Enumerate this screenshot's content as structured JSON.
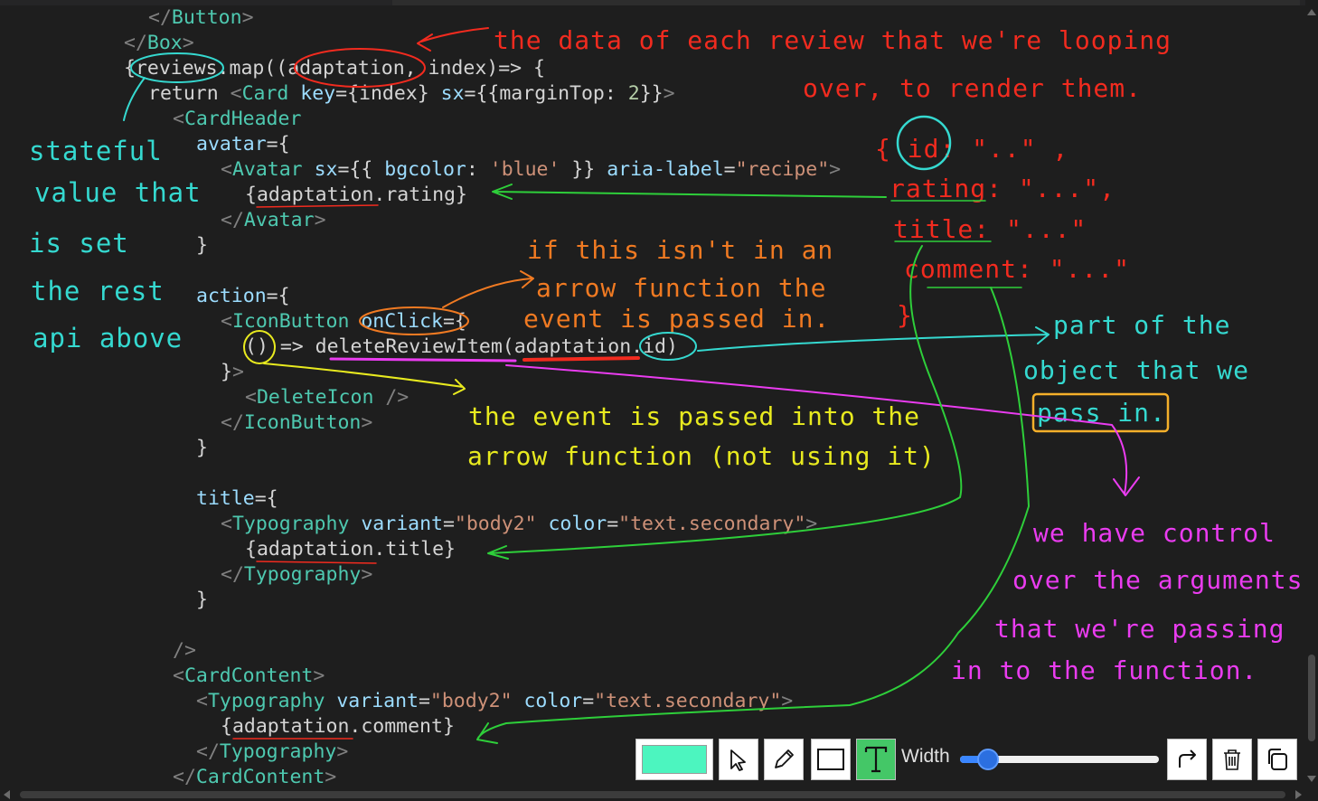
{
  "editor": {
    "code_lines": [
      {
        "parts": [
          [
            "br",
            "</"
          ],
          [
            "tag",
            "Button"
          ],
          [
            "br",
            ">"
          ]
        ]
      },
      {
        "parts": [
          [
            "br",
            "</"
          ],
          [
            "tag",
            "Box"
          ],
          [
            "br",
            ">"
          ]
        ]
      },
      {
        "parts": [
          [
            "kw",
            "{reviews.map((adaptation, index)=> {"
          ]
        ]
      },
      {
        "parts": [
          [
            "kw",
            "return "
          ],
          [
            "br",
            "<"
          ],
          [
            "tag",
            "Card"
          ],
          [
            "kw",
            " "
          ],
          [
            "attr",
            "key"
          ],
          [
            "kw",
            "={index} "
          ],
          [
            "attr",
            "sx"
          ],
          [
            "kw",
            "={{marginTop: "
          ],
          [
            "num",
            "2"
          ],
          [
            "kw",
            "}}"
          ],
          [
            "br",
            ">"
          ]
        ]
      },
      {
        "parts": [
          [
            "br",
            "<"
          ],
          [
            "tag",
            "CardHeader"
          ]
        ]
      },
      {
        "parts": [
          [
            "attr",
            "avatar"
          ],
          [
            "kw",
            "={"
          ]
        ]
      },
      {
        "parts": [
          [
            "br",
            "<"
          ],
          [
            "tag",
            "Avatar"
          ],
          [
            "kw",
            " "
          ],
          [
            "attr",
            "sx"
          ],
          [
            "kw",
            "={{ "
          ],
          [
            "attr",
            "bgcolor"
          ],
          [
            "kw",
            ": "
          ],
          [
            "str",
            "'blue'"
          ],
          [
            "kw",
            " }} "
          ],
          [
            "attr",
            "aria-label"
          ],
          [
            "kw",
            "="
          ],
          [
            "str",
            "\"recipe\""
          ],
          [
            "br",
            ">"
          ]
        ]
      },
      {
        "parts": [
          [
            "kw",
            "{adaptation.rating}"
          ]
        ]
      },
      {
        "parts": [
          [
            "br",
            "</"
          ],
          [
            "tag",
            "Avatar"
          ],
          [
            "br",
            ">"
          ]
        ]
      },
      {
        "parts": [
          [
            "kw",
            "}"
          ]
        ]
      },
      {
        "parts": [
          [
            "kw",
            ""
          ]
        ]
      },
      {
        "parts": [
          [
            "attr",
            "action"
          ],
          [
            "kw",
            "={"
          ]
        ]
      },
      {
        "parts": [
          [
            "br",
            "<"
          ],
          [
            "tag",
            "IconButton"
          ],
          [
            "kw",
            " "
          ],
          [
            "attr",
            "onClick"
          ],
          [
            "kw",
            "={"
          ]
        ]
      },
      {
        "parts": [
          [
            "kw",
            "() => deleteReviewItem(adaptation.id)"
          ]
        ]
      },
      {
        "parts": [
          [
            "kw",
            "}"
          ],
          [
            "br",
            ">"
          ]
        ]
      },
      {
        "parts": [
          [
            "br",
            "<"
          ],
          [
            "tag",
            "DeleteIcon"
          ],
          [
            "kw",
            " "
          ],
          [
            "br",
            "/>"
          ]
        ]
      },
      {
        "parts": [
          [
            "br",
            "</"
          ],
          [
            "tag",
            "IconButton"
          ],
          [
            "br",
            ">"
          ]
        ]
      },
      {
        "parts": [
          [
            "kw",
            "}"
          ]
        ]
      },
      {
        "parts": [
          [
            "kw",
            ""
          ]
        ]
      },
      {
        "parts": [
          [
            "attr",
            "title"
          ],
          [
            "kw",
            "={"
          ]
        ]
      },
      {
        "parts": [
          [
            "br",
            "<"
          ],
          [
            "tag",
            "Typography"
          ],
          [
            "kw",
            " "
          ],
          [
            "attr",
            "variant"
          ],
          [
            "kw",
            "="
          ],
          [
            "str",
            "\"body2\""
          ],
          [
            "kw",
            " "
          ],
          [
            "attr",
            "color"
          ],
          [
            "kw",
            "="
          ],
          [
            "str",
            "\"text.secondary\""
          ],
          [
            "br",
            ">"
          ]
        ]
      },
      {
        "parts": [
          [
            "kw",
            "{adaptation.title}"
          ]
        ]
      },
      {
        "parts": [
          [
            "br",
            "</"
          ],
          [
            "tag",
            "Typography"
          ],
          [
            "br",
            ">"
          ]
        ]
      },
      {
        "parts": [
          [
            "kw",
            "}"
          ]
        ]
      },
      {
        "parts": [
          [
            "kw",
            ""
          ]
        ]
      },
      {
        "parts": [
          [
            "br",
            "/>"
          ]
        ]
      },
      {
        "parts": [
          [
            "br",
            "<"
          ],
          [
            "tag",
            "CardContent"
          ],
          [
            "br",
            ">"
          ]
        ]
      },
      {
        "parts": [
          [
            "br",
            "<"
          ],
          [
            "tag",
            "Typography"
          ],
          [
            "kw",
            " "
          ],
          [
            "attr",
            "variant"
          ],
          [
            "kw",
            "="
          ],
          [
            "str",
            "\"body2\""
          ],
          [
            "kw",
            " "
          ],
          [
            "attr",
            "color"
          ],
          [
            "kw",
            "="
          ],
          [
            "str",
            "\"text.secondary\""
          ],
          [
            "br",
            ">"
          ]
        ]
      },
      {
        "parts": [
          [
            "kw",
            "{adaptation.comment}"
          ]
        ]
      },
      {
        "parts": [
          [
            "br",
            "</"
          ],
          [
            "tag",
            "Typography"
          ],
          [
            "br",
            ">"
          ]
        ]
      },
      {
        "parts": [
          [
            "br",
            "</"
          ],
          [
            "tag",
            "CardContent"
          ],
          [
            "br",
            ">"
          ]
        ]
      }
    ]
  },
  "annotations": {
    "red_title_1": "the data of each review that we're looping",
    "red_title_2": "over, to render them.",
    "red_obj_1": "{ id: \"..\" ,",
    "red_obj_2": "rating: \"...\",",
    "red_obj_3": "title: \"...\"",
    "red_obj_4": "comment: \"...\"",
    "red_obj_5": "}",
    "cyan_1": "stateful",
    "cyan_2": "value that",
    "cyan_3": "is set",
    "cyan_4": "the rest",
    "cyan_5": "api above",
    "orange_1": "if this isn't in an",
    "orange_2": "arrow function the",
    "orange_3": "event is passed in.",
    "cyan_right_1": "part of the",
    "cyan_right_2": "object that we",
    "cyan_right_3": "pass in.",
    "yellow_1": "the event is passed into the",
    "yellow_2": "arrow function (not using it)",
    "magenta_1": "we have control",
    "magenta_2": "over the arguments",
    "magenta_3": "that we're passing",
    "magenta_4": "in to the function."
  },
  "toolbar": {
    "color": "#4cf5bf",
    "width_label": "Width",
    "width_value": 0.14,
    "icons": [
      "color-swatch-icon",
      "select-arrow-icon",
      "pen-icon",
      "rectangle-icon",
      "text-tool-icon",
      "redo-icon",
      "trash-icon",
      "copy-icon"
    ]
  },
  "colors": {
    "background": "#1e1e1e",
    "tag": "#4ec9b0",
    "attribute": "#9cdcfe",
    "string": "#ce9178",
    "ink_red": "#f22b1f",
    "ink_cyan": "#35d9d0",
    "ink_green": "#2ecf3a",
    "ink_magenta": "#ea3cf0",
    "ink_yellow": "#e8ea1f",
    "ink_orange": "#f07a22"
  }
}
